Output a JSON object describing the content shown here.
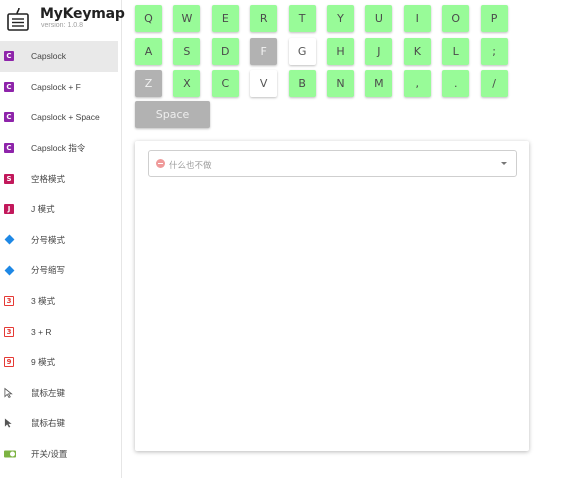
{
  "brand": {
    "title": "MyKeymap",
    "version": "version: 1.0.8"
  },
  "menu": [
    {
      "label": "Capslock",
      "icon": "c-square-purple-icon",
      "glyph": "C",
      "active": true
    },
    {
      "label": "Capslock + F",
      "icon": "c-square-purple-icon",
      "glyph": "C"
    },
    {
      "label": "Capslock + Space",
      "icon": "c-square-purple-icon",
      "glyph": "C"
    },
    {
      "label": "Capslock 指令",
      "icon": "c-square-purple-icon",
      "glyph": "C"
    },
    {
      "label": "空格模式",
      "icon": "s-square-magenta-icon",
      "glyph": "S"
    },
    {
      "label": "J 模式",
      "icon": "j-square-magenta-icon",
      "glyph": "J"
    },
    {
      "label": "分号模式",
      "icon": "blue-diamond-icon",
      "glyph": ""
    },
    {
      "label": "分号缩写",
      "icon": "blue-diamond-icon",
      "glyph": ""
    },
    {
      "label": "3 模式",
      "icon": "number-3-box-icon",
      "glyph": "3"
    },
    {
      "label": "3 + R",
      "icon": "number-3-box-icon",
      "glyph": "3"
    },
    {
      "label": "9 模式",
      "icon": "number-9-box-icon",
      "glyph": "9"
    },
    {
      "label": "鼠标左键",
      "icon": "cursor-outline-icon",
      "glyph": ""
    },
    {
      "label": "鼠标右键",
      "icon": "cursor-filled-icon",
      "glyph": ""
    },
    {
      "label": "开关/设置",
      "icon": "toggle-switch-icon",
      "glyph": ""
    }
  ],
  "keyboard": {
    "rows": [
      [
        {
          "k": "Q",
          "s": "mapped"
        },
        {
          "k": "W",
          "s": "mapped"
        },
        {
          "k": "E",
          "s": "mapped"
        },
        {
          "k": "R",
          "s": "mapped"
        },
        {
          "k": "T",
          "s": "mapped"
        },
        {
          "k": "Y",
          "s": "mapped"
        },
        {
          "k": "U",
          "s": "mapped"
        },
        {
          "k": "I",
          "s": "mapped"
        },
        {
          "k": "O",
          "s": "mapped"
        },
        {
          "k": "P",
          "s": "mapped"
        }
      ],
      [
        {
          "k": "A",
          "s": "mapped"
        },
        {
          "k": "S",
          "s": "mapped"
        },
        {
          "k": "D",
          "s": "mapped"
        },
        {
          "k": "F",
          "s": "disabled"
        },
        {
          "k": "G",
          "s": "selected"
        },
        {
          "k": "H",
          "s": "mapped"
        },
        {
          "k": "J",
          "s": "mapped"
        },
        {
          "k": "K",
          "s": "mapped"
        },
        {
          "k": "L",
          "s": "mapped"
        },
        {
          "k": ";",
          "s": "mapped"
        }
      ],
      [
        {
          "k": "Z",
          "s": "disabled"
        },
        {
          "k": "X",
          "s": "mapped"
        },
        {
          "k": "C",
          "s": "mapped"
        },
        {
          "k": "V",
          "s": "unmapped"
        },
        {
          "k": "B",
          "s": "mapped"
        },
        {
          "k": "N",
          "s": "mapped"
        },
        {
          "k": "M",
          "s": "mapped"
        },
        {
          "k": ",",
          "s": "mapped"
        },
        {
          "k": ".",
          "s": "mapped"
        },
        {
          "k": "/",
          "s": "mapped"
        }
      ]
    ],
    "space_label": "Space"
  },
  "action_select": {
    "value": "什么也不做",
    "icon": "minus-circle-icon"
  },
  "colors": {
    "mapped": "#98fb98",
    "disabled": "#b2b2b2",
    "unmapped": "#ffffff",
    "accent_purple": "#8e24aa",
    "accent_magenta": "#c2185b",
    "accent_blue": "#1e88e5",
    "toggle_green": "#7cb342"
  }
}
